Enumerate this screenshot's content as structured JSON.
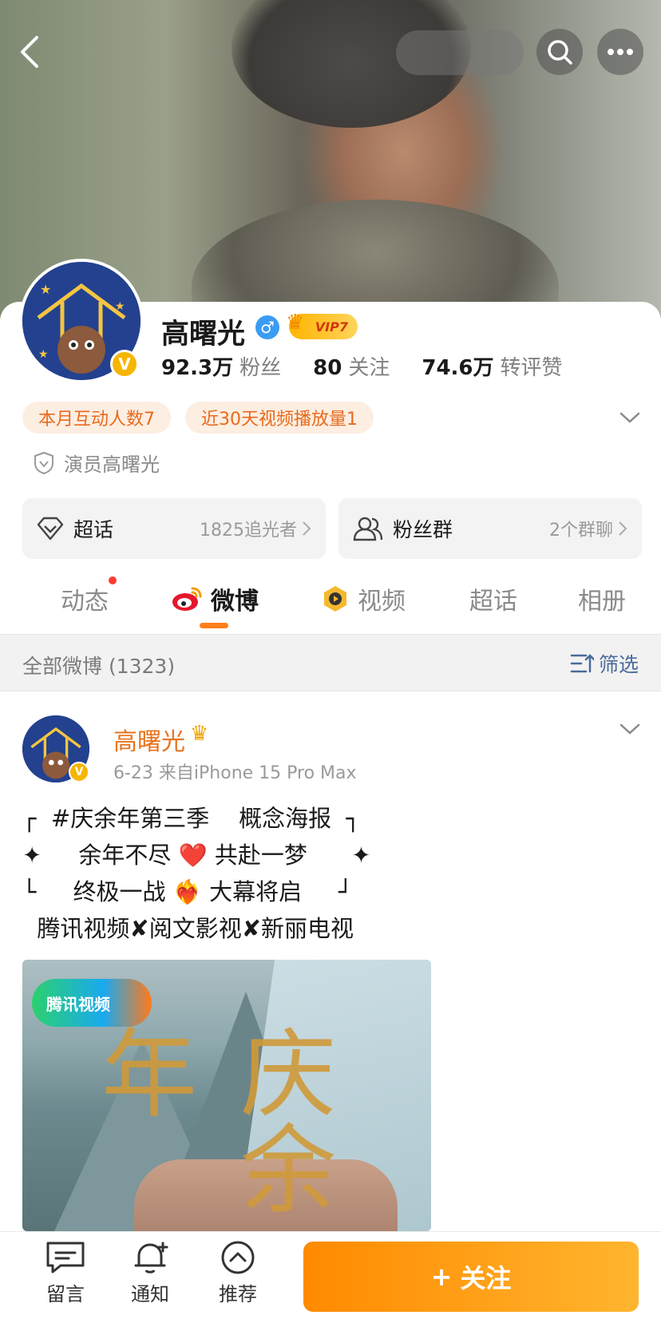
{
  "profile": {
    "name": "高曙光",
    "gender_symbol": "♂",
    "vip_label": "VIP7",
    "verified_symbol": "V",
    "stats": [
      {
        "value": "92.3万",
        "label": "粉丝"
      },
      {
        "value": "80",
        "label": "关注"
      },
      {
        "value": "74.6万",
        "label": "转评赞"
      }
    ],
    "chips": [
      "本月互动人数7",
      "近30天视频播放量1"
    ],
    "verification": "演员高曙光"
  },
  "entries": {
    "supertopic": {
      "title": "超话",
      "meta": "1825追光者"
    },
    "fangroup": {
      "title": "粉丝群",
      "meta": "2个群聊"
    }
  },
  "tabs": [
    "动态",
    "微博",
    "视频",
    "超话",
    "相册"
  ],
  "filter": {
    "count": "全部微博 (1323)",
    "button": "筛选"
  },
  "post": {
    "author": "高曙光",
    "meta": "6-23  来自iPhone 15 Pro Max",
    "lines": [
      "┌  #庆余年第三季    概念海报  ┐",
      "✦     余年不尽 ❤️ 共赴一梦      ✦",
      "└     终极一战 ❤️‍🔥 大幕将启     ┘",
      "  腾讯视频✘阅文影视✘新丽电视"
    ],
    "image_logo": "腾讯视频",
    "image_calligraphy": "庆余年"
  },
  "bottom": {
    "comment": "留言",
    "notify": "通知",
    "recommend": "推荐",
    "follow": "关注",
    "follow_plus": "+"
  },
  "colors": {
    "accent": "#ff8a00",
    "name_orange": "#e8731e",
    "chip_bg": "#fdeee2",
    "chip_text": "#e86a1c",
    "verified": "#f6b500",
    "gender_blue": "#3a9cf4"
  }
}
